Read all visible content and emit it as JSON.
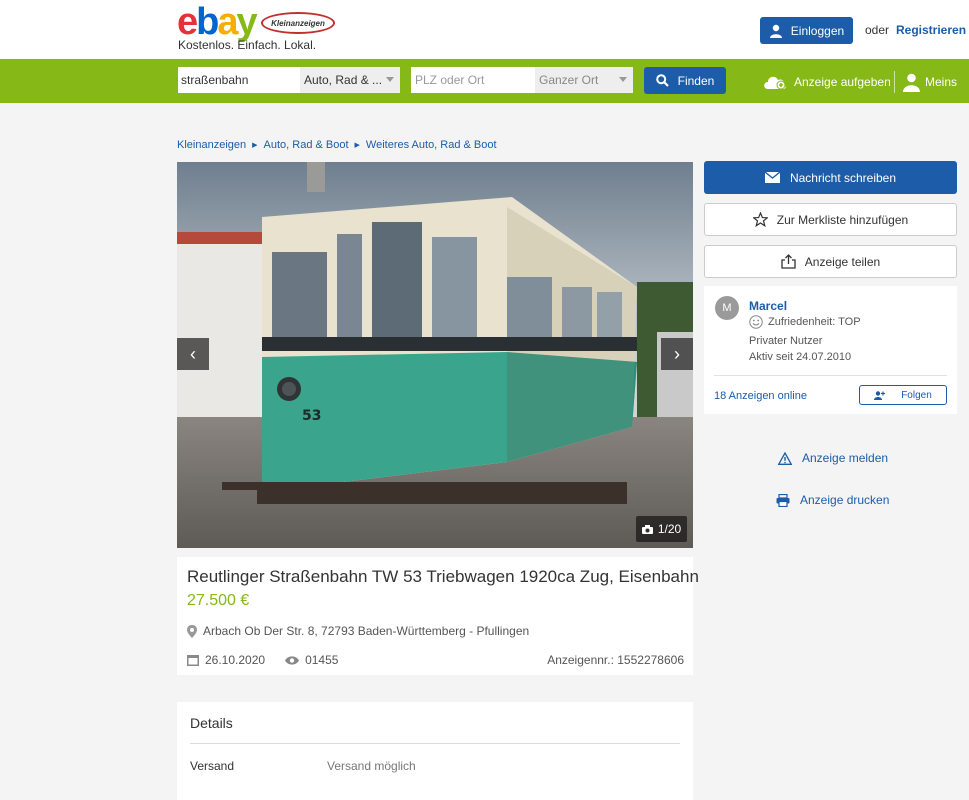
{
  "header": {
    "logo_text": "ebay",
    "logo_badge": "Kleinanzeigen",
    "tagline": "Kostenlos. Einfach. Lokal.",
    "login_label": "Einloggen",
    "or_label": "oder",
    "register_label": "Registrieren"
  },
  "search": {
    "query": "straßenbahn",
    "category": "Auto, Rad & ...",
    "location_placeholder": "PLZ oder Ort",
    "radius": "Ganzer Ort",
    "find_label": "Finden",
    "post_ad_label": "Anzeige aufgeben",
    "account_label": "Meins"
  },
  "breadcrumb": [
    "Kleinanzeigen",
    "Auto, Rad & Boot",
    "Weiteres Auto, Rad & Boot"
  ],
  "gallery": {
    "counter": "1/20",
    "tram_number": "53"
  },
  "ad": {
    "title": "Reutlinger Straßenbahn TW 53 Triebwagen 1920ca Zug, Eisenbahn",
    "price": "27.500 €",
    "location": "Arbach Ob Der Str. 8, 72793 Baden-Württemberg - Pfullingen",
    "date": "26.10.2020",
    "views": "01455",
    "ad_number": "Anzeigennr.: 1552278606"
  },
  "details": {
    "title": "Details",
    "rows": [
      {
        "key": "Versand",
        "value": "Versand möglich"
      }
    ]
  },
  "actions": {
    "message": "Nachricht schreiben",
    "watchlist": "Zur Merkliste hinzufügen",
    "share": "Anzeige teilen",
    "report": "Anzeige melden",
    "print": "Anzeige drucken"
  },
  "seller": {
    "initial": "M",
    "name": "Marcel",
    "rating": "Zufriedenheit: TOP",
    "type": "Privater Nutzer",
    "since": "Aktiv seit 24.07.2010",
    "ads_online": "18 Anzeigen online",
    "follow_label": "Folgen"
  },
  "colors": {
    "brand_green": "#86b817",
    "brand_blue": "#1c5ca8",
    "price_green": "#86b817",
    "tram_green": "#3aa58c"
  }
}
